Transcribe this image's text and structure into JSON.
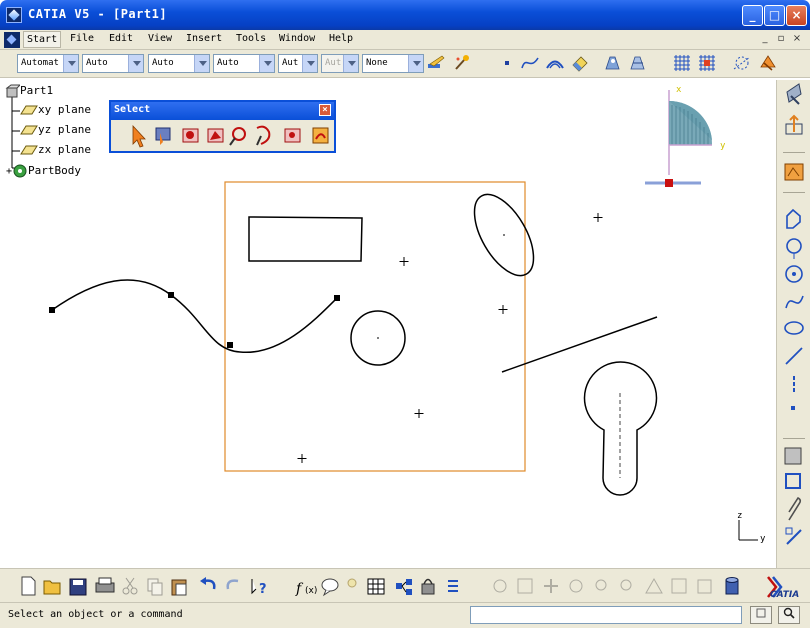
{
  "window": {
    "title": "CATIA V5 - [Part1]",
    "minimize": "_",
    "maximize": "□",
    "close": "×"
  },
  "menu": {
    "items": [
      "Start",
      "File",
      "Edit",
      "View",
      "Insert",
      "Tools",
      "Window",
      "Help"
    ],
    "mdi_min": "_",
    "mdi_restore": "▫",
    "mdi_close": "×"
  },
  "toolbar": {
    "combos": [
      {
        "value": "Automat",
        "disabled": false
      },
      {
        "value": "Auto",
        "disabled": false
      },
      {
        "value": "Auto",
        "disabled": false
      },
      {
        "value": "Auto",
        "disabled": false
      },
      {
        "value": "Aut",
        "disabled": false
      },
      {
        "value": "Aut",
        "disabled": true
      },
      {
        "value": "None",
        "disabled": false
      }
    ]
  },
  "tree": {
    "root": "Part1",
    "items": [
      "xy plane",
      "yz plane",
      "zx plane",
      "PartBody"
    ]
  },
  "select_panel": {
    "title": "Select"
  },
  "compass": {
    "x_label": "x",
    "y_label": "y"
  },
  "axis": {
    "z_label": "z",
    "y_label": "y"
  },
  "status": {
    "message": "Select an object or a command"
  },
  "brand": {
    "logo_text": "CATIA"
  },
  "colors": {
    "title_blue": "#0a4fd8",
    "selection_box": "#e08a2a",
    "face": "#ece9d8"
  }
}
